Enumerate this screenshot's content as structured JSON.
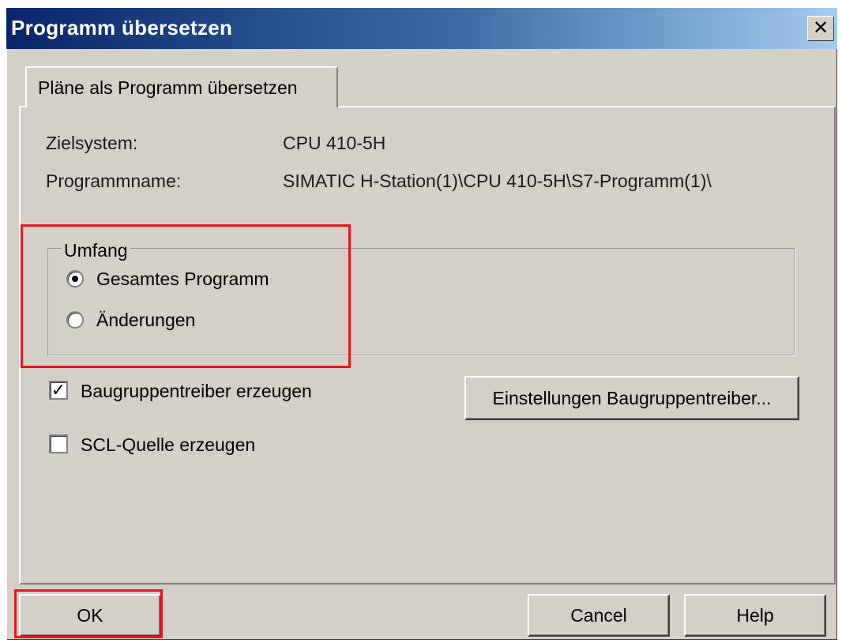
{
  "window": {
    "title": "Programm übersetzen",
    "close_symbol": "✕"
  },
  "tab": {
    "label": "Pläne als Programm übersetzen"
  },
  "info": {
    "target_label": "Zielsystem:",
    "target_value": "CPU 410-5H",
    "program_label": "Programmname:",
    "program_value": "SIMATIC H-Station(1)\\CPU 410-5H\\S7-Programm(1)\\"
  },
  "scope": {
    "legend": "Umfang",
    "options": [
      {
        "label": "Gesamtes Programm",
        "selected": true
      },
      {
        "label": "Änderungen",
        "selected": false
      }
    ]
  },
  "options": {
    "driver_label": "Baugruppentreiber erzeugen",
    "driver_checked": true,
    "scl_label": "SCL-Quelle erzeugen",
    "scl_checked": false,
    "check_symbol": "✓",
    "driver_settings_button": "Einstellungen Baugruppentreiber..."
  },
  "buttons": {
    "ok": "OK",
    "cancel": "Cancel",
    "help": "Help"
  },
  "highlight_color": "#e8141b"
}
